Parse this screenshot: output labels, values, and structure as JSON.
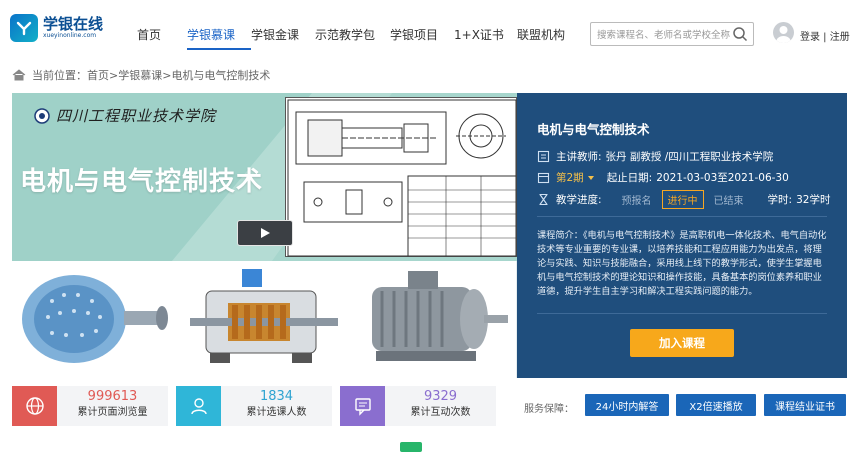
{
  "brand": {
    "name": "学银在线",
    "domain": "xueyinonline.com"
  },
  "nav": {
    "items": [
      "首页",
      "学银慕课",
      "学银金课",
      "示范教学包",
      "学银项目",
      "1+X证书",
      "联盟机构"
    ],
    "active_index": 1
  },
  "search": {
    "placeholder": "搜索课程名、老师名或学校全称"
  },
  "account": {
    "login_label": "登录 | 注册"
  },
  "breadcrumb": {
    "prefix": "当前位置：",
    "items": [
      "首页",
      "学银慕课",
      "电机与电气控制技术"
    ],
    "separator": " > "
  },
  "banner": {
    "school_name": "四川工程职业技术学院",
    "title": "电机与电气控制技术"
  },
  "course": {
    "title": "电机与电气控制技术",
    "teacher_label": "主讲教师:",
    "teacher_value": "张丹 副教授 /四川工程职业技术学院",
    "period": "第2期",
    "date_label": "起止日期:",
    "date_value": "2021-03-03至2021-06-30",
    "progress_label": "教学进度:",
    "stages": [
      "预报名",
      "进行中",
      "已结束"
    ],
    "active_stage_index": 1,
    "hours_label": "学时:",
    "hours_value": "32学时",
    "intro": "课程简介：《电机与电气控制技术》是高职机电一体化技术、电气自动化技术等专业重要的专业课，以培养技能和工程应用能力为出发点，将理论与实践、知识与技能融合，采用线上线下的教学形式，使学生掌握电机与电气控制技术的理论知识和操作技能，具备基本的岗位素养和职业道德，提升学生自主学习和解决工程实践问题的能力。",
    "join_label": "加入课程"
  },
  "stats": [
    {
      "value": "999613",
      "label": "累计页面浏览量",
      "color": "#e05a55",
      "num_color": "#e05a55",
      "icon": "globe-icon"
    },
    {
      "value": "1834",
      "label": "累计选课人数",
      "color": "#2fb6d8",
      "num_color": "#2fa4d1",
      "icon": "users-icon"
    },
    {
      "value": "9329",
      "label": "累计互动次数",
      "color": "#8a6ecf",
      "num_color": "#8a6ecf",
      "icon": "chat-icon"
    }
  ],
  "services": {
    "label": "服务保障：",
    "items": [
      "24小时内解答",
      "X2倍速播放",
      "课程结业证书"
    ]
  },
  "colors": {
    "accent": "#1a63c6",
    "panel": "#1f4e7d",
    "cta": "#f7a81b"
  }
}
